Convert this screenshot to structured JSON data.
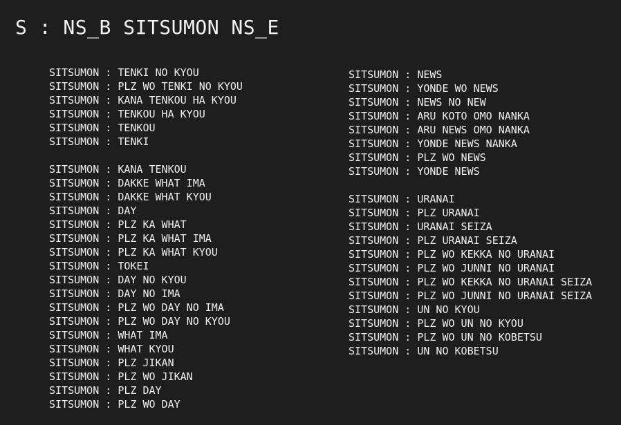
{
  "heading": "S : NS_B SITSUMON NS_E",
  "left_groups": [
    [
      "SITSUMON : TENKI NO KYOU",
      "SITSUMON : PLZ WO TENKI NO KYOU",
      "SITSUMON : KANA TENKOU HA KYOU",
      "SITSUMON : TENKOU HA KYOU",
      "SITSUMON : TENKOU",
      "SITSUMON : TENKI"
    ],
    [
      "SITSUMON : KANA TENKOU",
      "SITSUMON : DAKKE WHAT IMA",
      "SITSUMON : DAKKE WHAT KYOU",
      "SITSUMON : DAY",
      "SITSUMON : PLZ KA WHAT",
      "SITSUMON : PLZ KA WHAT IMA",
      "SITSUMON : PLZ KA WHAT KYOU",
      "SITSUMON : TOKEI",
      "SITSUMON : DAY NO KYOU",
      "SITSUMON : DAY NO IMA",
      "SITSUMON : PLZ WO DAY NO IMA",
      "SITSUMON : PLZ WO DAY NO KYOU",
      "SITSUMON : WHAT IMA",
      "SITSUMON : WHAT KYOU",
      "SITSUMON : PLZ JIKAN",
      "SITSUMON : PLZ WO JIKAN",
      "SITSUMON : PLZ DAY",
      "SITSUMON : PLZ WO DAY"
    ]
  ],
  "right_groups": [
    [
      "SITSUMON : NEWS",
      "SITSUMON : YONDE WO NEWS",
      "SITSUMON : NEWS NO NEW",
      "SITSUMON : ARU KOTO OMO NANKA",
      "SITSUMON : ARU NEWS OMO NANKA",
      "SITSUMON : YONDE NEWS NANKA",
      "SITSUMON : PLZ WO NEWS",
      "SITSUMON : YONDE NEWS"
    ],
    [
      "SITSUMON : URANAI",
      "SITSUMON : PLZ URANAI",
      "SITSUMON : URANAI SEIZA",
      "SITSUMON : PLZ URANAI SEIZA",
      "SITSUMON : PLZ WO KEKKA NO URANAI",
      "SITSUMON : PLZ WO JUNNI NO URANAI",
      "SITSUMON : PLZ WO KEKKA NO URANAI SEIZA",
      "SITSUMON : PLZ WO JUNNI NO URANAI SEIZA",
      "SITSUMON : UN NO KYOU",
      "SITSUMON : PLZ WO UN NO KYOU",
      "SITSUMON : PLZ WO UN NO KOBETSU",
      "SITSUMON : UN NO KOBETSU"
    ]
  ]
}
